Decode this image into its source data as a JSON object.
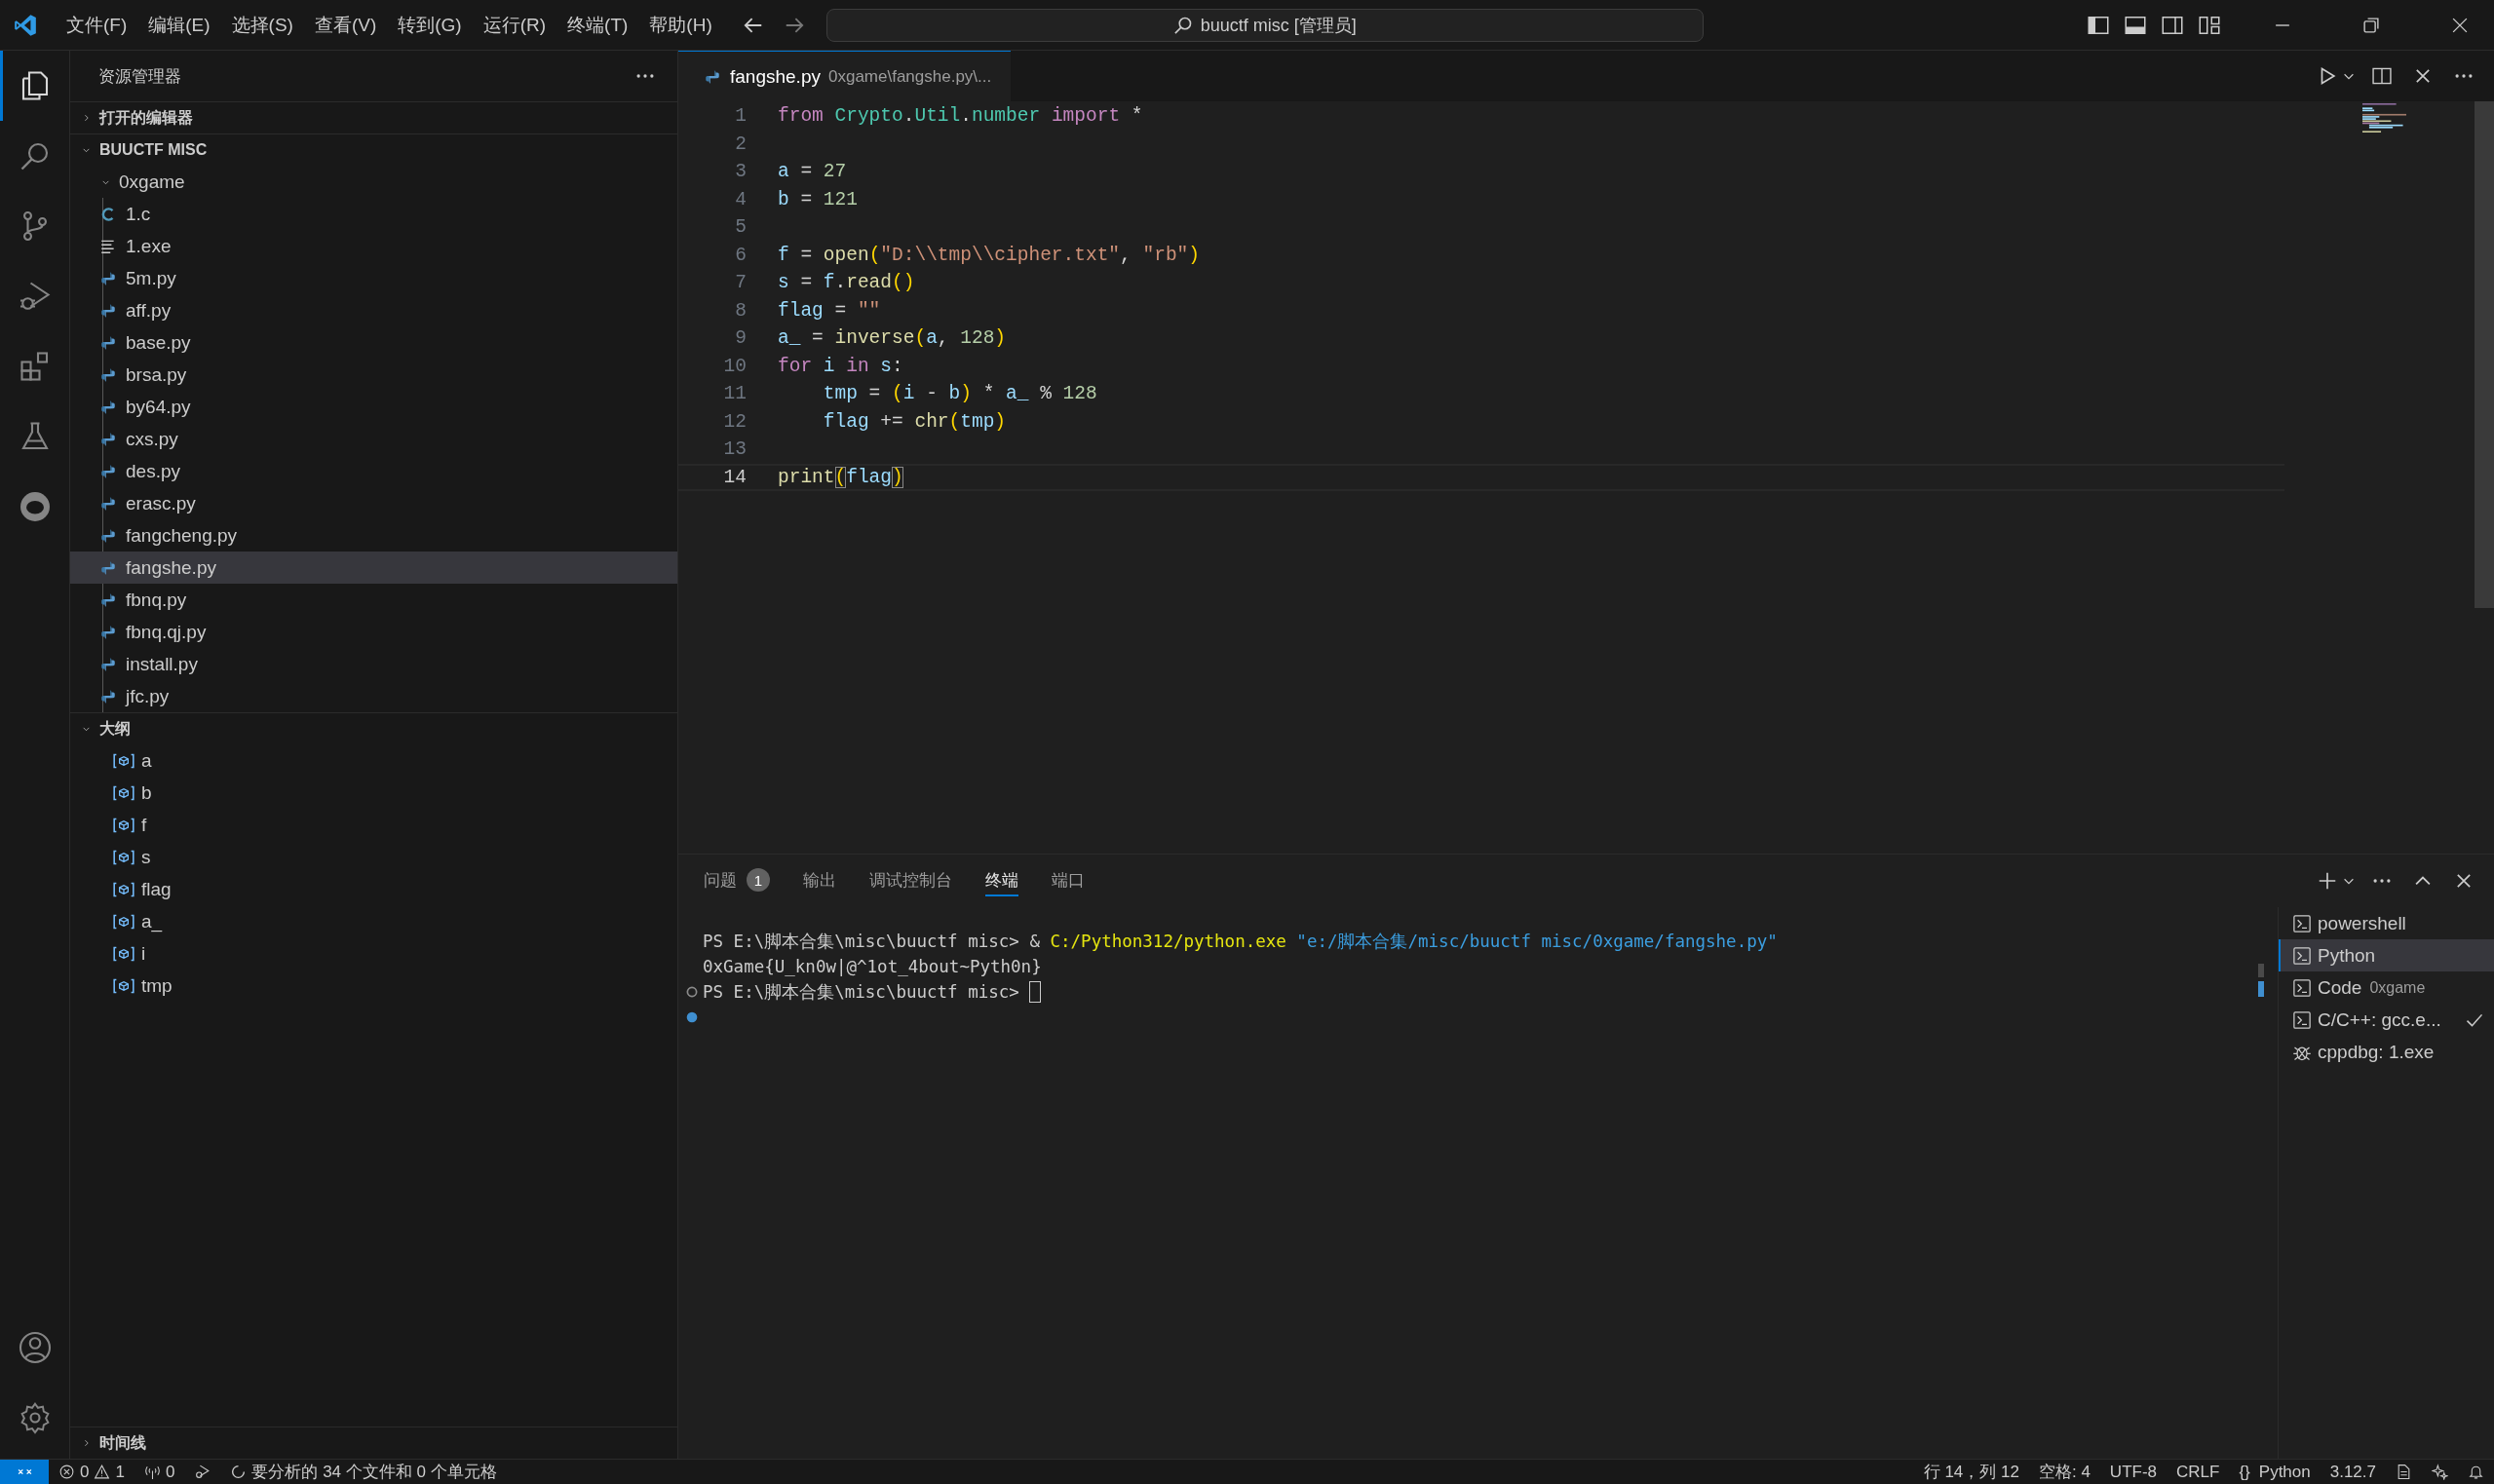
{
  "title_bar": {
    "menu": [
      "文件(F)",
      "编辑(E)",
      "选择(S)",
      "查看(V)",
      "转到(G)",
      "运行(R)",
      "终端(T)",
      "帮助(H)"
    ],
    "search": "buuctf misc [管理员]"
  },
  "sidebar": {
    "title": "资源管理器",
    "sections": [
      {
        "kind": "tree",
        "label": "打开的编辑器",
        "expanded": false
      },
      {
        "kind": "tree",
        "label": "BUUCTF MISC",
        "expanded": true,
        "children": [
          {
            "label": "0xgame",
            "expanded": true,
            "children": [
              {
                "label": "1.c",
                "kind": "c",
                "selected": false
              },
              {
                "label": "1.exe",
                "kind": "exe",
                "selected": false
              },
              {
                "label": "5m.py",
                "kind": "py",
                "selected": false
              },
              {
                "label": "aff.py",
                "kind": "py",
                "selected": false
              },
              {
                "label": "base.py",
                "kind": "py",
                "selected": false
              },
              {
                "label": "brsa.py",
                "kind": "py",
                "selected": false
              },
              {
                "label": "by64.py",
                "kind": "py",
                "selected": false
              },
              {
                "label": "cxs.py",
                "kind": "py",
                "selected": false
              },
              {
                "label": "des.py",
                "kind": "py",
                "selected": false
              },
              {
                "label": "erasc.py",
                "kind": "py",
                "selected": false
              },
              {
                "label": "fangcheng.py",
                "kind": "py",
                "selected": false
              },
              {
                "label": "fangshe.py",
                "kind": "py",
                "selected": true
              },
              {
                "label": "fbnq.py",
                "kind": "py",
                "selected": false
              },
              {
                "label": "fbnq.qj.py",
                "kind": "py",
                "selected": false
              },
              {
                "label": "install.py",
                "kind": "py",
                "selected": false
              },
              {
                "label": "jfc.py",
                "kind": "py",
                "selected": false
              }
            ]
          }
        ]
      },
      {
        "kind": "outline",
        "label": "大纲",
        "expanded": true,
        "items": [
          {
            "label": "a"
          },
          {
            "label": "b"
          },
          {
            "label": "f"
          },
          {
            "label": "s"
          },
          {
            "label": "flag"
          },
          {
            "label": "a_"
          },
          {
            "label": "i"
          },
          {
            "label": "tmp"
          }
        ]
      },
      {
        "kind": "tree",
        "label": "时间线",
        "expanded": false
      }
    ]
  },
  "editor": {
    "tab": {
      "name": "fangshe.py",
      "path": "0xgame\\fangshe.py\\..."
    },
    "lines": [
      {
        "number": "1",
        "current": false,
        "tokens": [
          {
            "kind": "kw",
            "text": "from "
          },
          {
            "kind": "mod",
            "text": "Crypto"
          },
          {
            "kind": "op",
            "text": "."
          },
          {
            "kind": "mod",
            "text": "Util"
          },
          {
            "kind": "op",
            "text": "."
          },
          {
            "kind": "mod",
            "text": "number "
          },
          {
            "kind": "kw",
            "text": "import"
          },
          {
            "kind": "op",
            "text": " *"
          }
        ]
      },
      {
        "number": "2",
        "current": false
      },
      {
        "number": "3",
        "current": false,
        "tokens": [
          {
            "kind": "var",
            "text": "a"
          },
          {
            "kind": "op",
            "text": " = "
          },
          {
            "kind": "num",
            "text": "27"
          }
        ]
      },
      {
        "number": "4",
        "current": false,
        "tokens": [
          {
            "kind": "var",
            "text": "b"
          },
          {
            "kind": "op",
            "text": " = "
          },
          {
            "kind": "num",
            "text": "121"
          }
        ]
      },
      {
        "number": "5",
        "current": false
      },
      {
        "number": "6",
        "current": false,
        "tokens": [
          {
            "kind": "var",
            "text": "f"
          },
          {
            "kind": "op",
            "text": " = "
          },
          {
            "kind": "fn",
            "text": "open"
          },
          {
            "kind": "br",
            "text": "("
          },
          {
            "kind": "str",
            "text": "\"D:\\\\tmp\\\\cipher.txt\""
          },
          {
            "kind": "op",
            "text": ", "
          },
          {
            "kind": "str",
            "text": "\"rb\""
          },
          {
            "kind": "br",
            "text": ")"
          }
        ]
      },
      {
        "number": "7",
        "current": false,
        "tokens": [
          {
            "kind": "var",
            "text": "s"
          },
          {
            "kind": "op",
            "text": " = "
          },
          {
            "kind": "var",
            "text": "f"
          },
          {
            "kind": "op",
            "text": "."
          },
          {
            "kind": "fn",
            "text": "read"
          },
          {
            "kind": "br",
            "text": "()"
          }
        ]
      },
      {
        "number": "8",
        "current": false,
        "tokens": [
          {
            "kind": "var",
            "text": "flag"
          },
          {
            "kind": "op",
            "text": " = "
          },
          {
            "kind": "str",
            "text": "\"\""
          }
        ]
      },
      {
        "number": "9",
        "current": false,
        "tokens": [
          {
            "kind": "var",
            "text": "a_"
          },
          {
            "kind": "op",
            "text": " = "
          },
          {
            "kind": "fn",
            "text": "inverse"
          },
          {
            "kind": "br",
            "text": "("
          },
          {
            "kind": "var",
            "text": "a"
          },
          {
            "kind": "op",
            "text": ", "
          },
          {
            "kind": "num",
            "text": "128"
          },
          {
            "kind": "br",
            "text": ")"
          }
        ]
      },
      {
        "number": "10",
        "current": false,
        "tokens": [
          {
            "kind": "kw",
            "text": "for "
          },
          {
            "kind": "var",
            "text": "i "
          },
          {
            "kind": "kw",
            "text": "in "
          },
          {
            "kind": "var",
            "text": "s"
          },
          {
            "kind": "op",
            "text": ":"
          }
        ]
      },
      {
        "number": "11",
        "current": false,
        "tokens": [
          {
            "kind": "var",
            "text": "    tmp"
          },
          {
            "kind": "op",
            "text": " = "
          },
          {
            "kind": "br",
            "text": "("
          },
          {
            "kind": "var",
            "text": "i"
          },
          {
            "kind": "op",
            "text": " - "
          },
          {
            "kind": "var",
            "text": "b"
          },
          {
            "kind": "br",
            "text": ")"
          },
          {
            "kind": "op",
            "text": " * "
          },
          {
            "kind": "var",
            "text": "a_"
          },
          {
            "kind": "op",
            "text": " % "
          },
          {
            "kind": "num",
            "text": "128"
          }
        ]
      },
      {
        "number": "12",
        "current": false,
        "tokens": [
          {
            "kind": "var",
            "text": "    flag"
          },
          {
            "kind": "op",
            "text": " += "
          },
          {
            "kind": "fn",
            "text": "chr"
          },
          {
            "kind": "br",
            "text": "("
          },
          {
            "kind": "var",
            "text": "tmp"
          },
          {
            "kind": "br",
            "text": ")"
          }
        ]
      },
      {
        "number": "13",
        "current": false
      },
      {
        "number": "14",
        "current": true,
        "tokens": [
          {
            "kind": "fn",
            "text": "print"
          },
          {
            "kind": "brm",
            "text": "("
          },
          {
            "kind": "var",
            "text": "flag"
          },
          {
            "kind": "brm",
            "text": ")"
          }
        ]
      }
    ]
  },
  "panel": {
    "tabs": [
      {
        "label": "问题",
        "badge": "1",
        "selected": false
      },
      {
        "label": "输出",
        "selected": false
      },
      {
        "label": "调试控制台",
        "selected": false
      },
      {
        "label": "终端",
        "selected": true
      },
      {
        "label": "端口",
        "selected": false
      }
    ],
    "terminal": {
      "lines": [
        {
          "kind": "output",
          "cursor": false,
          "segments": [
            {
              "kind": "plain",
              "text": "PS E:\\脚本合集\\misc\\buuctf misc> & "
            },
            {
              "kind": "cmd",
              "text": "C:/Python312/python.exe"
            },
            {
              "kind": "str",
              "text": " \"e:/脚本合集/misc/buuctf misc/0xgame/fangshe.py\""
            }
          ]
        },
        {
          "kind": "output",
          "cursor": false,
          "segments": [
            {
              "kind": "plain",
              "text": "0xGame{U_kn0w|@^1ot_4bout~Pyth0n}"
            }
          ]
        },
        {
          "kind": "finished",
          "cursor": true,
          "segments": [
            {
              "kind": "plain",
              "text": "PS E:\\脚本合集\\misc\\buuctf misc> "
            }
          ]
        },
        {
          "kind": "running",
          "cursor": false
        }
      ]
    },
    "sessions": [
      {
        "kind": "shell",
        "label": "powershell",
        "selected": false,
        "done": false
      },
      {
        "kind": "shell",
        "label": "Python",
        "selected": true,
        "done": false
      },
      {
        "kind": "shell",
        "label": "Code",
        "detail": "0xgame",
        "selected": false,
        "done": false
      },
      {
        "kind": "shell",
        "label": "C/C++: gcc.e...",
        "selected": false,
        "done": true
      },
      {
        "kind": "debug",
        "label": "cppdbg: 1.exe",
        "selected": false,
        "done": false
      }
    ]
  },
  "status_bar": {
    "errors": "0",
    "warnings": "1",
    "ports": "0",
    "analysis": "要分析的 34 个文件和 0 个单元格",
    "position": "行 14，列 12",
    "indent": "空格: 4",
    "encoding": "UTF-8",
    "eol": "CRLF",
    "language_icon": "{}",
    "language": "Python",
    "version": "3.12.7"
  }
}
